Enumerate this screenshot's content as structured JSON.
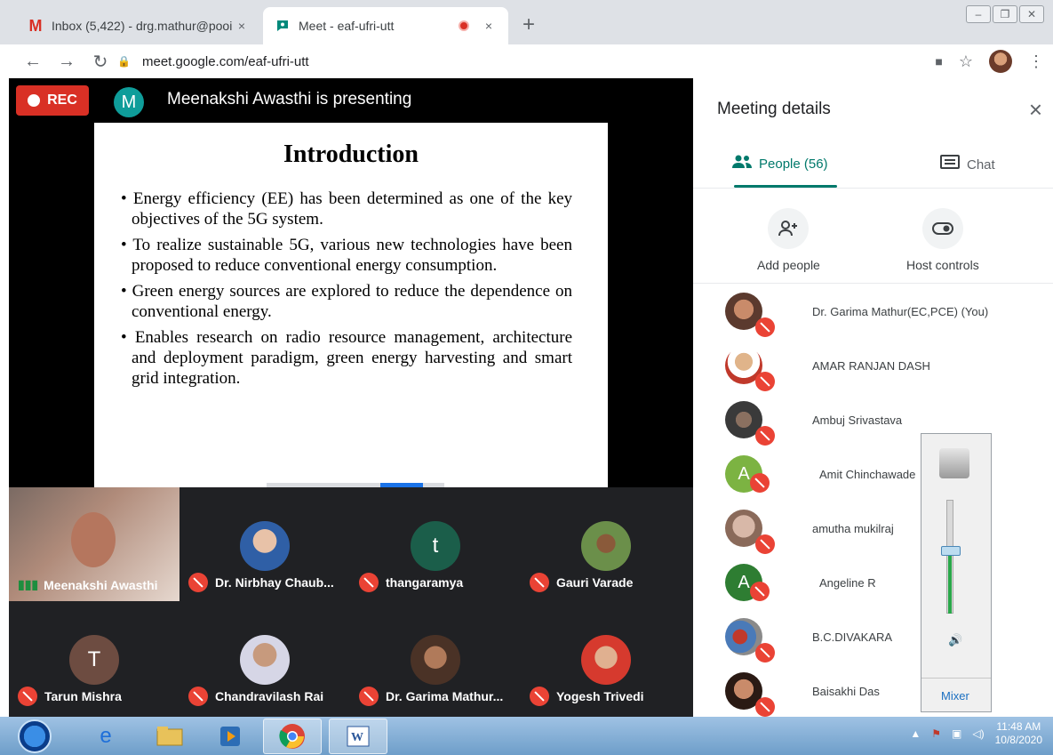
{
  "browser": {
    "tabs": [
      {
        "title": "Inbox (5,422) - drg.mathur@pooi",
        "icon": "gmail-icon"
      },
      {
        "title": "Meet - eaf-ufri-utt",
        "icon": "meet-icon",
        "recording": true
      }
    ],
    "url": "meet.google.com/eaf-ufri-utt",
    "new_tab": "+",
    "close_glyph": "×"
  },
  "meet": {
    "rec_label": "REC",
    "presenter_initial": "M",
    "presenting_text": "Meenakshi Awasthi is presenting",
    "slide": {
      "title": "Introduction",
      "bullets": [
        "Energy efficiency (EE) has been determined as one of the key objectives of the 5G system.",
        "To realize sustainable 5G, various new technologies have been proposed to reduce conventional energy consumption.",
        "Green energy sources are explored to reduce the dependence on conventional energy.",
        "Enables research on radio resource management, architecture and deployment paradigm, green energy harvesting and smart grid integration."
      ]
    },
    "tiles": [
      {
        "name": "Meenakshi Awasthi",
        "initial": "",
        "speaking": true
      },
      {
        "name": "Dr. Nirbhay Chaub...",
        "initial": ""
      },
      {
        "name": "thangaramya",
        "initial": "t"
      },
      {
        "name": "Gauri Varade",
        "initial": ""
      },
      {
        "name": "Tarun Mishra",
        "initial": "T"
      },
      {
        "name": "Chandravilash Rai",
        "initial": ""
      },
      {
        "name": "Dr. Garima Mathur...",
        "initial": ""
      },
      {
        "name": "Yogesh Trivedi",
        "initial": ""
      }
    ]
  },
  "panel": {
    "title": "Meeting details",
    "close": "×",
    "tab_people": "People (56)",
    "tab_chat": "Chat",
    "add_people": "Add people",
    "host_controls": "Host controls",
    "people": [
      {
        "name": "Dr. Garima Mathur(EC,PCE) (You)",
        "initial": ""
      },
      {
        "name": "AMAR RANJAN DASH",
        "initial": ""
      },
      {
        "name": "Ambuj Srivastava",
        "initial": ""
      },
      {
        "name": "Amit Chinchawade",
        "initial": "A"
      },
      {
        "name": "amutha mukilraj",
        "initial": ""
      },
      {
        "name": "Angeline R",
        "initial": "A"
      },
      {
        "name": "B.C.DIVAKARA",
        "initial": ""
      },
      {
        "name": "Baisakhi Das",
        "initial": ""
      }
    ]
  },
  "mixer": {
    "label": "Mixer",
    "level": 0.55
  },
  "taskbar": {
    "time": "11:48 AM",
    "date": "10/8/2020"
  },
  "colors": {
    "meet_teal": "#00796b",
    "rec_red": "#d93025",
    "mute_red": "#ea4335"
  }
}
